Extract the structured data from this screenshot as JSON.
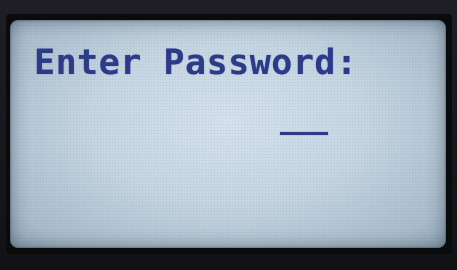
{
  "display": {
    "prompt_text": "Enter Password:",
    "text_color": "#2c3a8a",
    "backlight_color": "#c6d6e2"
  },
  "password_field": {
    "value": ""
  }
}
